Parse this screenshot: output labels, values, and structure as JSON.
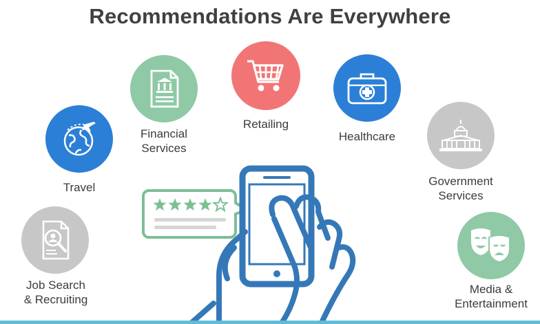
{
  "title": "Recommendations Are Everywhere",
  "categories": [
    {
      "id": "travel",
      "lines": [
        "Travel"
      ],
      "color": "#2b7fd6",
      "icon": "globe-plane-icon"
    },
    {
      "id": "financial",
      "lines": [
        "Financial",
        "Services"
      ],
      "color": "#8fc9a6",
      "icon": "bank-document-icon"
    },
    {
      "id": "retailing",
      "lines": [
        "Retailing"
      ],
      "color": "#f27575",
      "icon": "shopping-cart-icon"
    },
    {
      "id": "healthcare",
      "lines": [
        "Healthcare"
      ],
      "color": "#2b7fd6",
      "icon": "medical-kit-icon"
    },
    {
      "id": "government",
      "lines": [
        "Government",
        "Services"
      ],
      "color": "#c7c7c7",
      "icon": "capitol-building-icon"
    },
    {
      "id": "jobsearch",
      "lines": [
        "Job Search",
        "& Recruiting"
      ],
      "color": "#c7c7c7",
      "icon": "resume-magnifier-icon"
    },
    {
      "id": "media",
      "lines": [
        "Media &",
        "Entertainment"
      ],
      "color": "#8fc9a6",
      "icon": "theater-masks-icon"
    }
  ],
  "review": {
    "stars_filled": 4,
    "stars_total": 5
  },
  "colors": {
    "phone": "#3578b8",
    "bubble": "#7cbf95",
    "bar": "#62bcd6"
  }
}
